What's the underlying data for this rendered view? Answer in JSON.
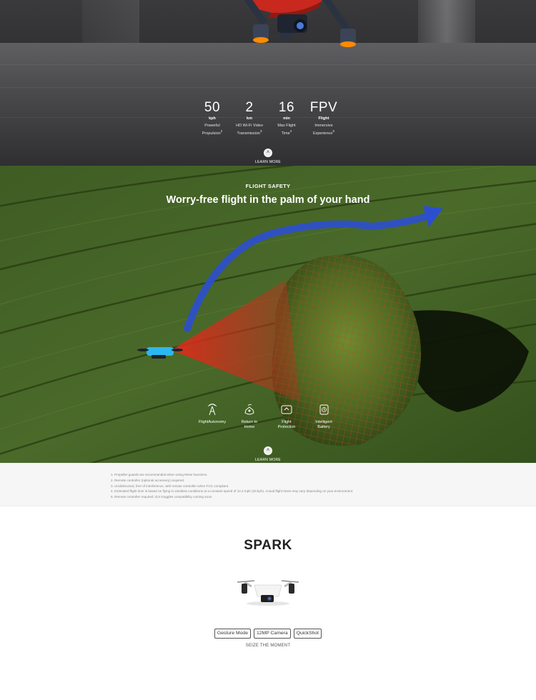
{
  "hero": {
    "stats": [
      {
        "value": "50",
        "unit": "kph",
        "desc": "Powerful\nPropulsion",
        "note": "2"
      },
      {
        "value": "2",
        "unit": "km",
        "desc": "HD Wi-Fi Video\nTransmission",
        "note": "3"
      },
      {
        "value": "16",
        "unit": "min",
        "desc": "Max Flight\nTime",
        "note": "4"
      },
      {
        "value": "FPV",
        "unit": "Flight",
        "desc": "Immersive\nExperience",
        "note": "5"
      }
    ],
    "learn_more": "LEARN MORE"
  },
  "safety": {
    "eyebrow": "FLIGHT SAFETY",
    "headline": "Worry-free flight in the palm of your hand",
    "features": [
      {
        "label": "FlightAutonomy",
        "icon": "antenna-icon"
      },
      {
        "label": "Return to\nHome",
        "icon": "return-home-icon"
      },
      {
        "label": "Flight\nProtection",
        "icon": "flight-protection-icon"
      },
      {
        "label": "Intelligent\nBattery",
        "icon": "battery-icon"
      }
    ],
    "learn_more": "LEARN MORE"
  },
  "footnotes": [
    "1. Propeller guards are recommended when using these functions.",
    "2. Remote controller (optional accessory) required.",
    "3. Unobstructed, free of interference, with remote controller when FCC compliant.",
    "4. Estimated flight time is based on flying in windless conditions at a constant speed of 12.4 mph (20 kph). Actual flight times may vary depending on your environment.",
    "5. Remote controller required. DJI Goggles compatibility coming soon."
  ],
  "product": {
    "name": "SPARK",
    "chips": [
      "Gesture Mode",
      "12MP Camera",
      "QuickShot"
    ],
    "tagline": "SEIZE THE MOMENT"
  },
  "colors": {
    "hero_bg": "#2d2d2f",
    "field_green": "#3e5a22",
    "scan_red": "#d2321e",
    "path_blue": "#2c4fd0",
    "drone_red": "#c8281e",
    "drone_cyan": "#2bb8f0"
  }
}
